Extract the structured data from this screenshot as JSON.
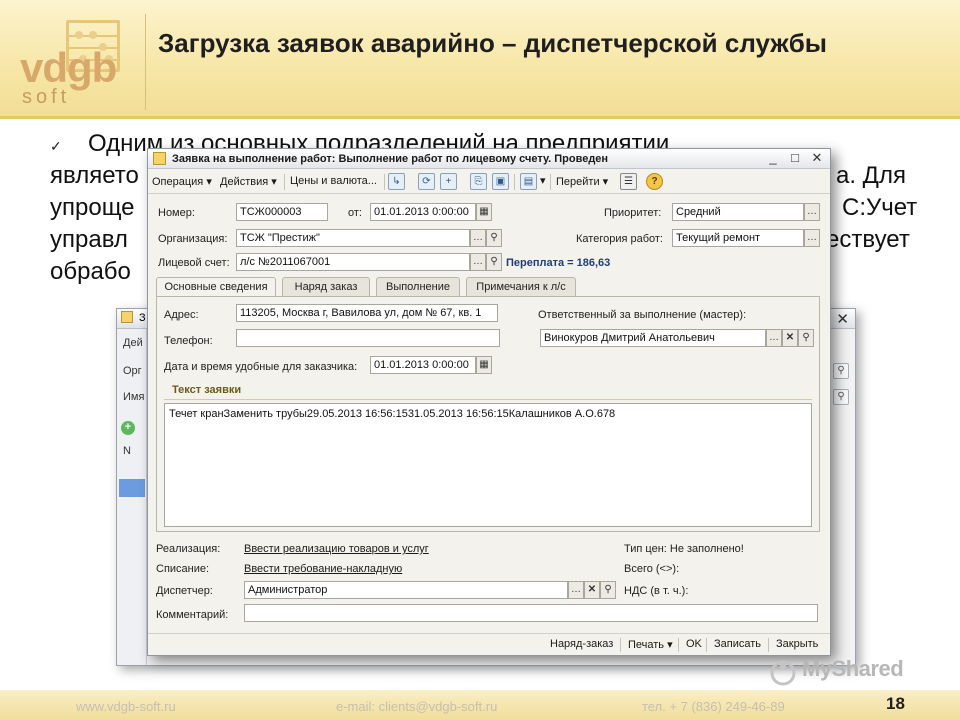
{
  "slide": {
    "logo_text": "vdgb",
    "logo_sub": "soft",
    "title": "Загрузка заявок аварийно – диспетчерской службы",
    "bullet_lines": [
      "Одним из основных подразделений на предприятии",
      "являето",
      "упроще",
      "управл",
      "обрабо"
    ],
    "bullet_tails": [
      "",
      "а. Для",
      "С:Учет",
      "ествует",
      ""
    ],
    "page_number": "18",
    "footer": {
      "site": "www.vdgb-soft.ru",
      "email": "e-mail: clients@vdgb-soft.ru",
      "phone": "тел. + 7 (836) 249-46-89"
    },
    "watermark": "MyShared"
  },
  "back_window": {
    "title_fragment": "З",
    "side_labels": [
      "Дей",
      "Орг",
      "Имя",
      "N"
    ]
  },
  "window": {
    "title": "Заявка на выполнение работ: Выполнение работ по лицевому счету. Проведен",
    "controls": {
      "minimize": "_",
      "maximize": "□",
      "close": "✕"
    },
    "toolbar": {
      "operation": "Операция ▾",
      "actions": "Действия ▾",
      "prices": "Цены и валюта...",
      "goto": "Перейти ▾",
      "help": "?"
    },
    "fields": {
      "number_label": "Номер:",
      "number": "ТСЖ000003",
      "date_label": "от:",
      "date": "01.01.2013  0:00:00",
      "priority_label": "Приоритет:",
      "priority": "Средний",
      "org_label": "Организация:",
      "org": "ТСЖ \"Престиж\"",
      "work_cat_label": "Категория работ:",
      "work_cat": "Текущий ремонт",
      "account_label": "Лицевой счет:",
      "account": "л/с №2011067001",
      "overpay": "Переплата = 186,63"
    },
    "tabs": [
      "Основные сведения",
      "Наряд заказ",
      "Выполнение",
      "Примечания к л/с"
    ],
    "main_tab": {
      "address_label": "Адрес:",
      "address": "113205, Москва г, Вавилова ул, дом № 67, кв. 1",
      "responsible_label": "Ответственный за выполнение (мастер):",
      "responsible": "Винокуров Дмитрий Анатольевич",
      "phone_label": "Телефон:",
      "phone": "",
      "datetime_label": "Дата и время удобные для заказчика:",
      "datetime": "01.01.2013  0:00:00",
      "request_text_title": "Текст заявки",
      "request_text": "Течет кранЗаменить трубы29.05.2013 16:56:1531.05.2013 16:56:15Калашников А.О.678"
    },
    "bottom": {
      "realization_label": "Реализация:",
      "realization_link": "Ввести реализацию товаров и услуг",
      "writeoff_label": "Списание:",
      "writeoff_link": "Ввести требование-накладную",
      "dispatcher_label": "Диспетчер:",
      "dispatcher": "Администратор",
      "comment_label": "Комментарий:",
      "comment": "",
      "price_type": "Тип цен: Не заполнено!",
      "total": "Всего (<>):",
      "vat": "НДС (в т. ч.):"
    },
    "statusbar": {
      "order": "Наряд-заказ",
      "print": "Печать ▾",
      "ok": "OK",
      "save": "Записать",
      "close": "Закрыть"
    }
  }
}
